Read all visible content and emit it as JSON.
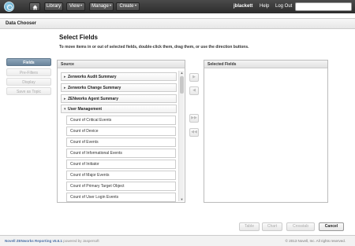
{
  "nav": {
    "library": "Library",
    "view": "View",
    "manage": "Manage",
    "create": "Create",
    "user": "jblackett",
    "help": "Help",
    "logout": "Log Out",
    "search_value": ""
  },
  "window": {
    "title": "Data Chooser"
  },
  "steps": [
    {
      "label": "Fields",
      "active": true
    },
    {
      "label": "Pre-Filters",
      "active": false
    },
    {
      "label": "Display",
      "active": false
    },
    {
      "label": "Save as Topic",
      "active": false
    }
  ],
  "main": {
    "heading": "Select Fields",
    "instructions": "To move items in or out of selected fields, double-click them, drag them, or use the direction buttons."
  },
  "source": {
    "header": "Source",
    "categories": [
      "Zenworks Audit Summary",
      "Zenworks Change Summary",
      "ZENworks Agent Summary",
      "User Management"
    ],
    "fields": [
      "Count of Critical Events",
      "Count of Device",
      "Count of Events",
      "Count of Informational Events",
      "Count of Initiator",
      "Count of Major Events",
      "Count of Primary Target Object",
      "Count of User Login Events"
    ]
  },
  "selected": {
    "header": "Selected Fields"
  },
  "buttons": {
    "table": "Table",
    "chart": "Chart",
    "crosstab": "Crosstab",
    "cancel": "Cancel"
  },
  "footer": {
    "product": "Novell ZENworks Reporting v5.6.1",
    "powered": "powered by Jaspersoft",
    "copyright": "© 2013 Novell, Inc. All rights reserved."
  },
  "colors": {
    "topbar": "#333333",
    "active_step": "#7a93a9",
    "footer_link": "#4a6fa5"
  }
}
